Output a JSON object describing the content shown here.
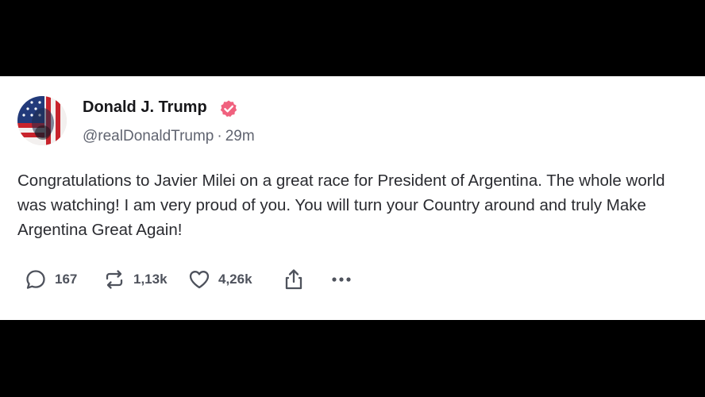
{
  "post": {
    "author": {
      "display_name": "Donald J. Trump",
      "handle": "@realDonaldTrump",
      "verified": true,
      "avatar_icon": "profile-photo-flag"
    },
    "separator": "·",
    "timestamp": "29m",
    "text": "Congratulations to Javier Milei on a great race for President of Argentina. The whole world was watching! I am very proud of you. You will turn your Country around and truly Make Argentina Great Again!",
    "actions": {
      "replies": "167",
      "retruths": "1,13k",
      "likes": "4,26k"
    }
  },
  "colors": {
    "verified_badge": "#f0617e",
    "icon": "#4e525c",
    "text": "#2a2b30",
    "muted": "#606470",
    "background": "#ffffff",
    "letterbox": "#000000"
  }
}
